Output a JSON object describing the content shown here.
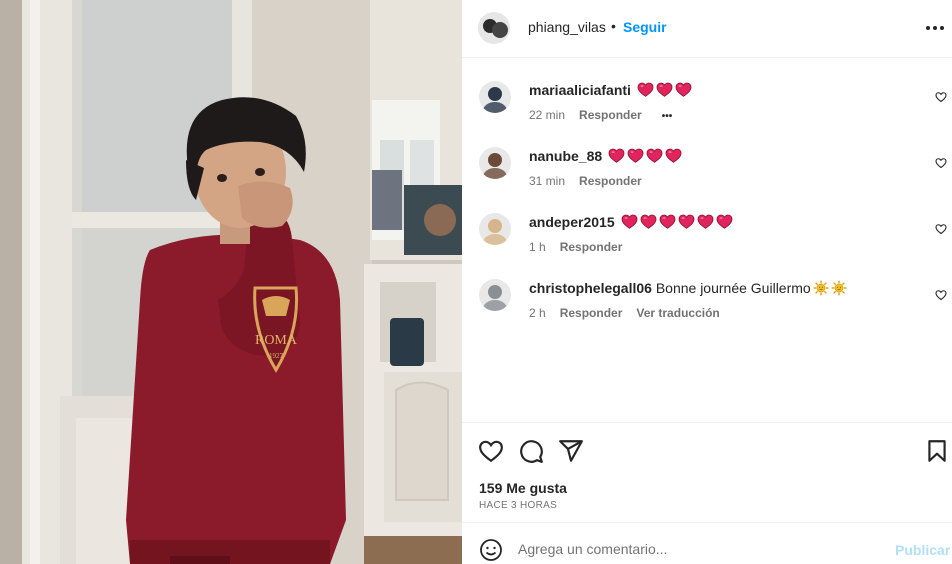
{
  "post": {
    "author": "phiang_vilas",
    "separator": "•",
    "follow_label": "Seguir",
    "more_icon": "more-horizontal-icon",
    "photo_shirt_text": "ROMA",
    "photo_shirt_year": "1927"
  },
  "comments": [
    {
      "user": "mariaaliciafanti",
      "text": "",
      "emojis": [
        "heart",
        "heart",
        "heart"
      ],
      "time": "22 min",
      "reply_label": "Responder",
      "extra": "•••",
      "avatar_color": "#2b3a4a"
    },
    {
      "user": "nanube_88",
      "text": "",
      "emojis": [
        "heart",
        "heart",
        "heart",
        "heart"
      ],
      "time": "31 min",
      "reply_label": "Responder",
      "extra": "",
      "avatar_color": "#6b4a3a"
    },
    {
      "user": "andeper2015",
      "text": "",
      "emojis": [
        "heart",
        "heart",
        "heart",
        "heart",
        "heart",
        "heart"
      ],
      "time": "1 h",
      "reply_label": "Responder",
      "extra": "",
      "avatar_color": "#d8b48a"
    },
    {
      "user": "christophelegall06",
      "text": "Bonne journée Guillermo",
      "emojis": [
        "sun",
        "sun"
      ],
      "time": "2 h",
      "reply_label": "Responder",
      "extra": "Ver traducción",
      "avatar_color": "#8a8f94"
    }
  ],
  "actions": {
    "like_icon": "heart-outline-icon",
    "comment_icon": "comment-icon",
    "share_icon": "send-icon",
    "save_icon": "bookmark-icon",
    "likes_text": "159 Me gusta",
    "time_text": "HACE 3 HORAS"
  },
  "add_comment": {
    "emoji_icon": "smiley-icon",
    "placeholder": "Agrega un comentario...",
    "publish_label": "Publicar"
  },
  "colors": {
    "accent": "#0095f6",
    "publish_disabled": "#b2dffc",
    "heart_emoji": "#e0245e",
    "shirt": "#8b1a2a"
  }
}
